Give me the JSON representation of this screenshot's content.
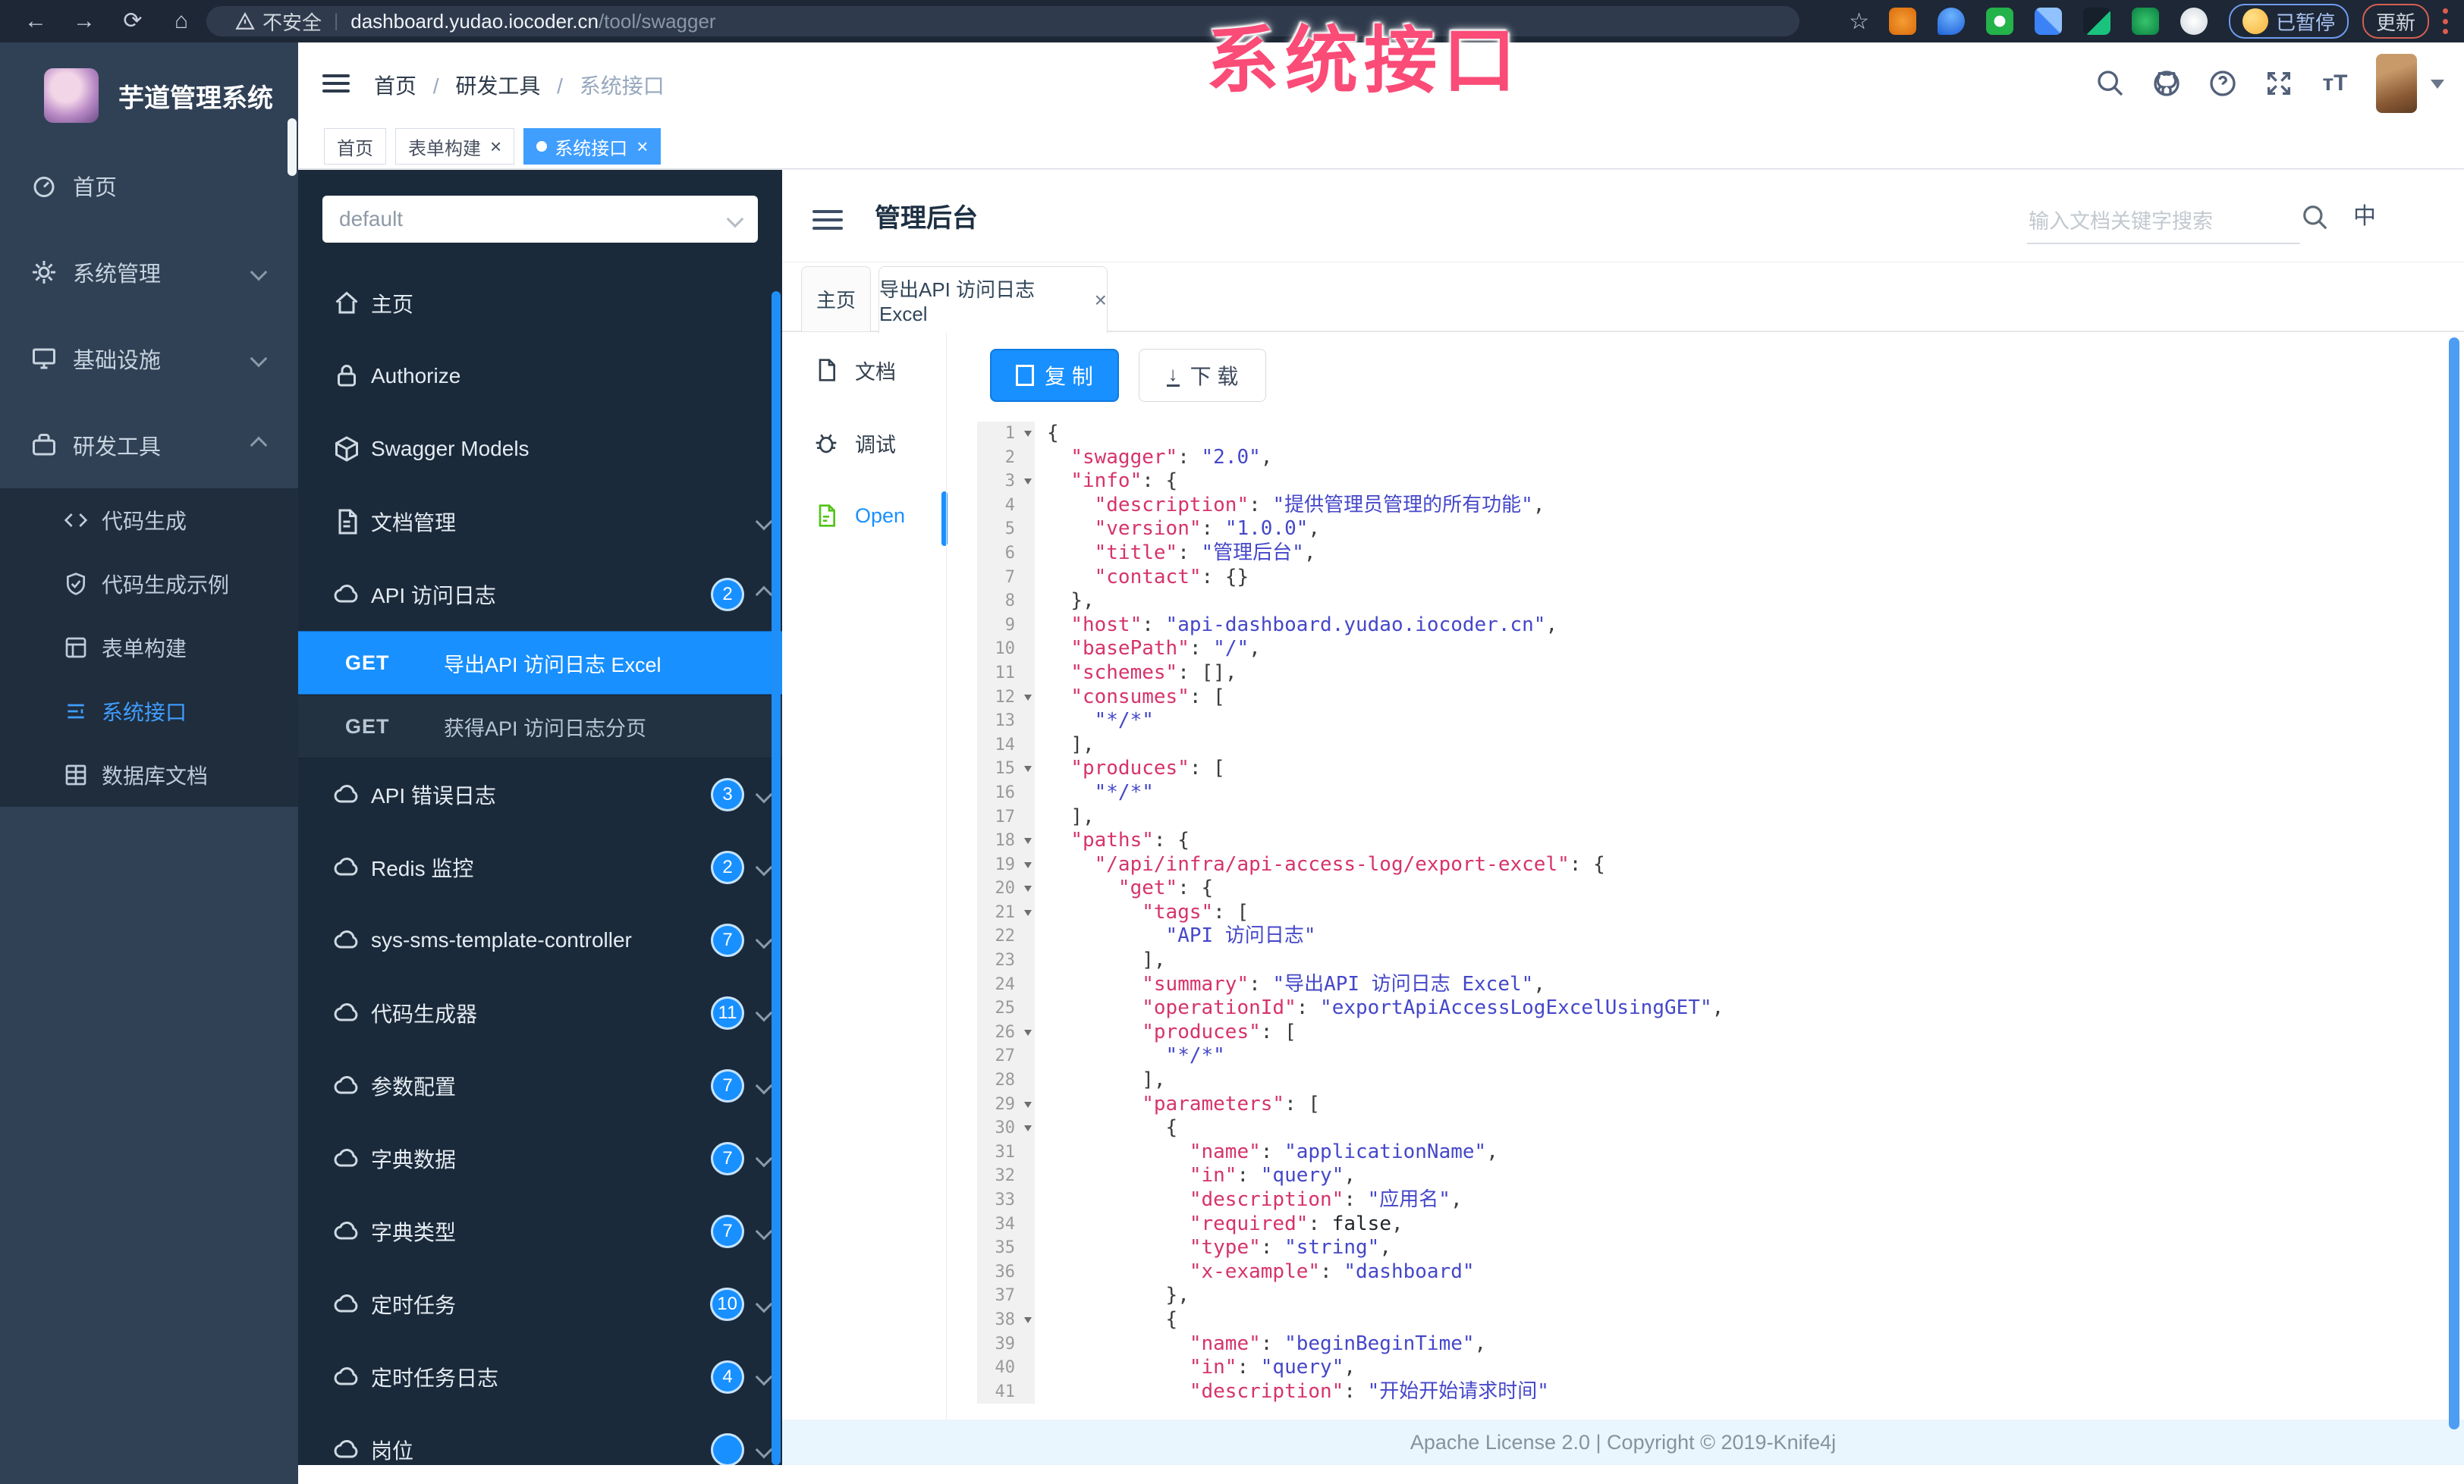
{
  "browser": {
    "security_label": "不安全",
    "url_host": "dashboard.yudao.iocoder.cn",
    "url_path": "/tool/swagger",
    "paused_label": "已暂停",
    "update_label": "更新"
  },
  "watermark": "系统接口",
  "app_sidebar": {
    "title": "芋道管理系统",
    "items": [
      {
        "key": "home",
        "label": "首页",
        "icon": "dash"
      },
      {
        "key": "system",
        "label": "系统管理",
        "icon": "gear",
        "chevron": "down"
      },
      {
        "key": "infra",
        "label": "基础设施",
        "icon": "infra",
        "chevron": "down"
      },
      {
        "key": "devtools",
        "label": "研发工具",
        "icon": "tools",
        "chevron": "up"
      }
    ],
    "sub_items": [
      {
        "key": "codegen",
        "label": "代码生成",
        "icon": "code"
      },
      {
        "key": "codegen-demo",
        "label": "代码生成示例",
        "icon": "shield"
      },
      {
        "key": "form-build",
        "label": "表单构建",
        "icon": "form"
      },
      {
        "key": "system-api",
        "label": "系统接口",
        "icon": "api",
        "active": true
      },
      {
        "key": "db-doc",
        "label": "数据库文档",
        "icon": "db"
      }
    ]
  },
  "header": {
    "breadcrumb": [
      "首页",
      "研发工具",
      "系统接口"
    ]
  },
  "tags": [
    {
      "label": "首页"
    },
    {
      "label": "表单构建",
      "closable": true
    },
    {
      "label": "系统接口",
      "closable": true,
      "active": true
    }
  ],
  "swagger_sidebar": {
    "group_select": "default",
    "items": [
      {
        "label": "主页",
        "icon": "home"
      },
      {
        "label": "Authorize",
        "icon": "lock"
      },
      {
        "label": "Swagger Models",
        "icon": "models"
      },
      {
        "label": "文档管理",
        "icon": "doc",
        "chevron": "down"
      },
      {
        "label": "API 访问日志",
        "icon": "cloud",
        "badge": "2",
        "chevron": "up"
      }
    ],
    "get_rows": [
      {
        "method": "GET",
        "label": "导出API 访问日志 Excel",
        "active": true
      },
      {
        "method": "GET",
        "label": "获得API 访问日志分页"
      }
    ],
    "badge_items": [
      {
        "label": "API 错误日志",
        "badge": "3"
      },
      {
        "label": "Redis 监控",
        "badge": "2"
      },
      {
        "label": "sys-sms-template-controller",
        "badge": "7"
      },
      {
        "label": "代码生成器",
        "badge": "11"
      },
      {
        "label": "参数配置",
        "badge": "7"
      },
      {
        "label": "字典数据",
        "badge": "7"
      },
      {
        "label": "字典类型",
        "badge": "7"
      },
      {
        "label": "定时任务",
        "badge": "10"
      },
      {
        "label": "定时任务日志",
        "badge": "4"
      },
      {
        "label": "岗位",
        "badge": ""
      }
    ]
  },
  "main": {
    "title": "管理后台",
    "search_placeholder": "输入文档关键字搜索",
    "lang_icon": "中",
    "tabs": [
      {
        "label": "主页"
      },
      {
        "label": "导出API 访问日志 Excel",
        "active": true,
        "closable": true
      }
    ],
    "doc_nav": [
      {
        "label": "文档",
        "icon": "docfile"
      },
      {
        "label": "调试",
        "icon": "bug"
      },
      {
        "label": "Open",
        "icon": "open",
        "active": true
      }
    ],
    "copy_label": "复 制",
    "download_label": "下 载",
    "footer": "Apache License 2.0 | Copyright © 2019-Knife4j"
  },
  "code": {
    "lines": [
      {
        "n": 1,
        "f": true,
        "i": 0,
        "s": [
          [
            "{",
            "p"
          ]
        ]
      },
      {
        "n": 2,
        "i": 2,
        "s": [
          [
            "\"swagger\"",
            "k"
          ],
          [
            ": ",
            "p"
          ],
          [
            "\"2.0\"",
            "v"
          ],
          [
            ",",
            "p"
          ]
        ]
      },
      {
        "n": 3,
        "f": true,
        "i": 2,
        "s": [
          [
            "\"info\"",
            "k"
          ],
          [
            ": {",
            "p"
          ]
        ]
      },
      {
        "n": 4,
        "i": 4,
        "s": [
          [
            "\"description\"",
            "k"
          ],
          [
            ": ",
            "p"
          ],
          [
            "\"提供管理员管理的所有功能\"",
            "v"
          ],
          [
            ",",
            "p"
          ]
        ]
      },
      {
        "n": 5,
        "i": 4,
        "s": [
          [
            "\"version\"",
            "k"
          ],
          [
            ": ",
            "p"
          ],
          [
            "\"1.0.0\"",
            "v"
          ],
          [
            ",",
            "p"
          ]
        ]
      },
      {
        "n": 6,
        "i": 4,
        "s": [
          [
            "\"title\"",
            "k"
          ],
          [
            ": ",
            "p"
          ],
          [
            "\"管理后台\"",
            "v"
          ],
          [
            ",",
            "p"
          ]
        ]
      },
      {
        "n": 7,
        "i": 4,
        "s": [
          [
            "\"contact\"",
            "k"
          ],
          [
            ": {}",
            "p"
          ]
        ]
      },
      {
        "n": 8,
        "i": 2,
        "s": [
          [
            "},",
            "p"
          ]
        ]
      },
      {
        "n": 9,
        "i": 2,
        "s": [
          [
            "\"host\"",
            "k"
          ],
          [
            ": ",
            "p"
          ],
          [
            "\"api-dashboard.yudao.iocoder.cn\"",
            "v"
          ],
          [
            ",",
            "p"
          ]
        ]
      },
      {
        "n": 10,
        "i": 2,
        "s": [
          [
            "\"basePath\"",
            "k"
          ],
          [
            ": ",
            "p"
          ],
          [
            "\"/\"",
            "v"
          ],
          [
            ",",
            "p"
          ]
        ]
      },
      {
        "n": 11,
        "i": 2,
        "s": [
          [
            "\"schemes\"",
            "k"
          ],
          [
            ": [],",
            "p"
          ]
        ]
      },
      {
        "n": 12,
        "f": true,
        "i": 2,
        "s": [
          [
            "\"consumes\"",
            "k"
          ],
          [
            ": [",
            "p"
          ]
        ]
      },
      {
        "n": 13,
        "i": 4,
        "s": [
          [
            "\"*/*\"",
            "v"
          ]
        ]
      },
      {
        "n": 14,
        "i": 2,
        "s": [
          [
            "],",
            "p"
          ]
        ]
      },
      {
        "n": 15,
        "f": true,
        "i": 2,
        "s": [
          [
            "\"produces\"",
            "k"
          ],
          [
            ": [",
            "p"
          ]
        ]
      },
      {
        "n": 16,
        "i": 4,
        "s": [
          [
            "\"*/*\"",
            "v"
          ]
        ]
      },
      {
        "n": 17,
        "i": 2,
        "s": [
          [
            "],",
            "p"
          ]
        ]
      },
      {
        "n": 18,
        "f": true,
        "i": 2,
        "s": [
          [
            "\"paths\"",
            "k"
          ],
          [
            ": {",
            "p"
          ]
        ]
      },
      {
        "n": 19,
        "f": true,
        "i": 4,
        "s": [
          [
            "\"/api/infra/api-access-log/export-excel\"",
            "k"
          ],
          [
            ": {",
            "p"
          ]
        ]
      },
      {
        "n": 20,
        "f": true,
        "i": 6,
        "s": [
          [
            "\"get\"",
            "k"
          ],
          [
            ": {",
            "p"
          ]
        ]
      },
      {
        "n": 21,
        "f": true,
        "i": 8,
        "s": [
          [
            "\"tags\"",
            "k"
          ],
          [
            ": [",
            "p"
          ]
        ]
      },
      {
        "n": 22,
        "i": 10,
        "s": [
          [
            "\"API 访问日志\"",
            "v"
          ]
        ]
      },
      {
        "n": 23,
        "i": 8,
        "s": [
          [
            "],",
            "p"
          ]
        ]
      },
      {
        "n": 24,
        "i": 8,
        "s": [
          [
            "\"summary\"",
            "k"
          ],
          [
            ": ",
            "p"
          ],
          [
            "\"导出API 访问日志 Excel\"",
            "v"
          ],
          [
            ",",
            "p"
          ]
        ]
      },
      {
        "n": 25,
        "i": 8,
        "s": [
          [
            "\"operationId\"",
            "k"
          ],
          [
            ": ",
            "p"
          ],
          [
            "\"exportApiAccessLogExcelUsingGET\"",
            "v"
          ],
          [
            ",",
            "p"
          ]
        ]
      },
      {
        "n": 26,
        "f": true,
        "i": 8,
        "s": [
          [
            "\"produces\"",
            "k"
          ],
          [
            ": [",
            "p"
          ]
        ]
      },
      {
        "n": 27,
        "i": 10,
        "s": [
          [
            "\"*/*\"",
            "v"
          ]
        ]
      },
      {
        "n": 28,
        "i": 8,
        "s": [
          [
            "],",
            "p"
          ]
        ]
      },
      {
        "n": 29,
        "f": true,
        "i": 8,
        "s": [
          [
            "\"parameters\"",
            "k"
          ],
          [
            ": [",
            "p"
          ]
        ]
      },
      {
        "n": 30,
        "f": true,
        "i": 10,
        "s": [
          [
            "{",
            "p"
          ]
        ]
      },
      {
        "n": 31,
        "i": 12,
        "s": [
          [
            "\"name\"",
            "k"
          ],
          [
            ": ",
            "p"
          ],
          [
            "\"applicationName\"",
            "v"
          ],
          [
            ",",
            "p"
          ]
        ]
      },
      {
        "n": 32,
        "i": 12,
        "s": [
          [
            "\"in\"",
            "k"
          ],
          [
            ": ",
            "p"
          ],
          [
            "\"query\"",
            "v"
          ],
          [
            ",",
            "p"
          ]
        ]
      },
      {
        "n": 33,
        "i": 12,
        "s": [
          [
            "\"description\"",
            "k"
          ],
          [
            ": ",
            "p"
          ],
          [
            "\"应用名\"",
            "v"
          ],
          [
            ",",
            "p"
          ]
        ]
      },
      {
        "n": 34,
        "i": 12,
        "s": [
          [
            "\"required\"",
            "k"
          ],
          [
            ": ",
            "p"
          ],
          [
            "false",
            "d"
          ],
          [
            ",",
            "p"
          ]
        ]
      },
      {
        "n": 35,
        "i": 12,
        "s": [
          [
            "\"type\"",
            "k"
          ],
          [
            ": ",
            "p"
          ],
          [
            "\"string\"",
            "v"
          ],
          [
            ",",
            "p"
          ]
        ]
      },
      {
        "n": 36,
        "i": 12,
        "s": [
          [
            "\"x-example\"",
            "k"
          ],
          [
            ": ",
            "p"
          ],
          [
            "\"dashboard\"",
            "v"
          ]
        ]
      },
      {
        "n": 37,
        "i": 10,
        "s": [
          [
            "},",
            "p"
          ]
        ]
      },
      {
        "n": 38,
        "f": true,
        "i": 10,
        "s": [
          [
            "{",
            "p"
          ]
        ]
      },
      {
        "n": 39,
        "i": 12,
        "s": [
          [
            "\"name\"",
            "k"
          ],
          [
            ": ",
            "p"
          ],
          [
            "\"beginBeginTime\"",
            "v"
          ],
          [
            ",",
            "p"
          ]
        ]
      },
      {
        "n": 40,
        "i": 12,
        "s": [
          [
            "\"in\"",
            "k"
          ],
          [
            ": ",
            "p"
          ],
          [
            "\"query\"",
            "v"
          ],
          [
            ",",
            "p"
          ]
        ]
      },
      {
        "n": 41,
        "i": 12,
        "s": [
          [
            "\"description\"",
            "k"
          ],
          [
            ": ",
            "p"
          ],
          [
            "\"开始开始请求时间\"",
            "v"
          ]
        ]
      }
    ]
  }
}
